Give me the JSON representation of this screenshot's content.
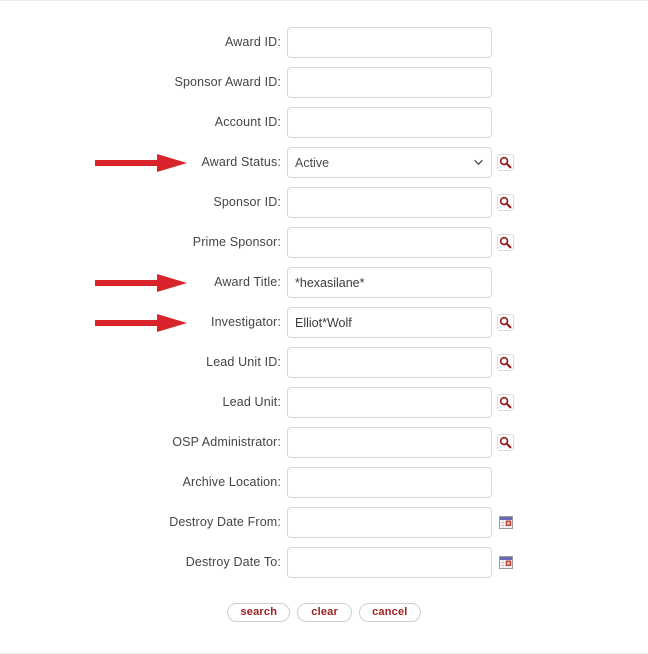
{
  "form": {
    "rows": [
      {
        "label": "Award ID:",
        "value": "",
        "control": "text",
        "icon": "none"
      },
      {
        "label": "Sponsor Award ID:",
        "value": "",
        "control": "text",
        "icon": "none"
      },
      {
        "label": "Account ID:",
        "value": "",
        "control": "text",
        "icon": "none"
      },
      {
        "label": "Award Status:",
        "value": "Active",
        "control": "select",
        "icon": "magnifier-icon"
      },
      {
        "label": "Sponsor ID:",
        "value": "",
        "control": "text",
        "icon": "magnifier-icon"
      },
      {
        "label": "Prime Sponsor:",
        "value": "",
        "control": "text",
        "icon": "magnifier-icon"
      },
      {
        "label": "Award Title:",
        "value": "*hexasilane*",
        "control": "text",
        "icon": "none"
      },
      {
        "label": "Investigator:",
        "value": "Elliot*Wolf",
        "control": "text",
        "icon": "magnifier-icon"
      },
      {
        "label": "Lead Unit ID:",
        "value": "",
        "control": "text",
        "icon": "magnifier-icon"
      },
      {
        "label": "Lead Unit:",
        "value": "",
        "control": "text",
        "icon": "magnifier-icon"
      },
      {
        "label": "OSP Administrator:",
        "value": "",
        "control": "text",
        "icon": "magnifier-icon"
      },
      {
        "label": "Archive Location:",
        "value": "",
        "control": "text",
        "icon": "none"
      },
      {
        "label": "Destroy Date From:",
        "value": "",
        "control": "text",
        "icon": "calendar-icon"
      },
      {
        "label": "Destroy Date To:",
        "value": "",
        "control": "text",
        "icon": "calendar-icon"
      }
    ],
    "status_options": [
      "Active"
    ]
  },
  "annotations": {
    "arrows": [
      {
        "target": "Award Status:"
      },
      {
        "target": "Award Title:"
      },
      {
        "target": "Investigator:"
      }
    ],
    "color": "#d8232a"
  },
  "buttons": [
    {
      "label": "search"
    },
    {
      "label": "clear"
    },
    {
      "label": "cancel"
    }
  ],
  "colors": {
    "label_text": "#444444",
    "value_text": "#3c3c3c",
    "field_border": "#d6d6d6",
    "button_text": "#9c2222",
    "button_border": "#cfcfcf",
    "arrow_red": "#d8232a",
    "magnifier_red": "#9b1c20",
    "calendar_blue": "#6a6ab4",
    "calendar_red": "#c0392b"
  }
}
